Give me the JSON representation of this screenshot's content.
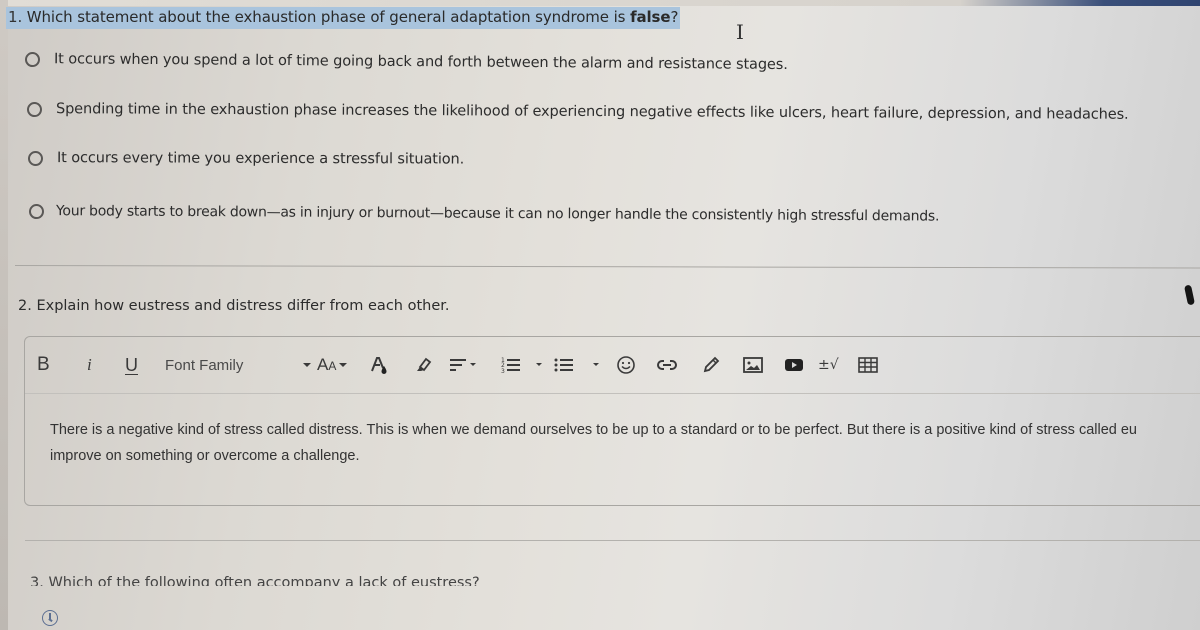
{
  "questions": [
    {
      "number": "1.",
      "prompt": "Which statement about the exhaustion phase of general adaptation syndrome is ",
      "prompt_emphasis": "false",
      "prompt_end": "?",
      "selected_text": true,
      "type": "multiple-choice",
      "options": [
        {
          "label": "It occurs when you spend a lot of time going back and forth between the alarm and resistance stages.",
          "selected": false
        },
        {
          "label": "Spending time in the exhaustion phase increases the likelihood of experiencing negative effects like ulcers, heart failure, depression, and headaches.",
          "selected": false
        },
        {
          "label": "It occurs every time you experience a stressful situation.",
          "selected": false
        },
        {
          "label": "Your body starts to break down—as in injury or burnout—because it can no longer handle the consistently high stressful demands.",
          "selected": false
        }
      ]
    },
    {
      "number": "2.",
      "prompt": "Explain how eustress and distress differ from each other.",
      "type": "essay",
      "editor": {
        "toolbar": {
          "bold": "B",
          "italic": "i",
          "underline": "U",
          "font_family": "Font Family",
          "font_size_large": "A",
          "font_size_small": "A",
          "math": "±√",
          "icons": [
            "bold-icon",
            "italic-icon",
            "underline-icon",
            "font-family-dropdown",
            "font-size-icon",
            "text-color-icon",
            "highlight-icon",
            "align-icon",
            "ordered-list-icon",
            "bullet-list-icon",
            "emoji-icon",
            "link-icon",
            "pencil-icon",
            "image-icon",
            "video-icon",
            "math-icon",
            "table-icon"
          ]
        },
        "content_line1": "There is a negative kind of stress called distress. This is when we demand ourselves to be up to a standard or to be perfect. But there is a positive kind of stress called eu",
        "content_line2": "improve on something or overcome a challenge."
      }
    },
    {
      "number": "3.",
      "prompt": "Which of the following often accompany a lack of eustress?",
      "type": "multiple-choice",
      "status_icon": "clock-icon"
    }
  ],
  "colors": {
    "selection": "#a9c4dd",
    "text": "#2b2b2b",
    "radio_border": "#5a5856",
    "clock": "#5c6f92"
  }
}
